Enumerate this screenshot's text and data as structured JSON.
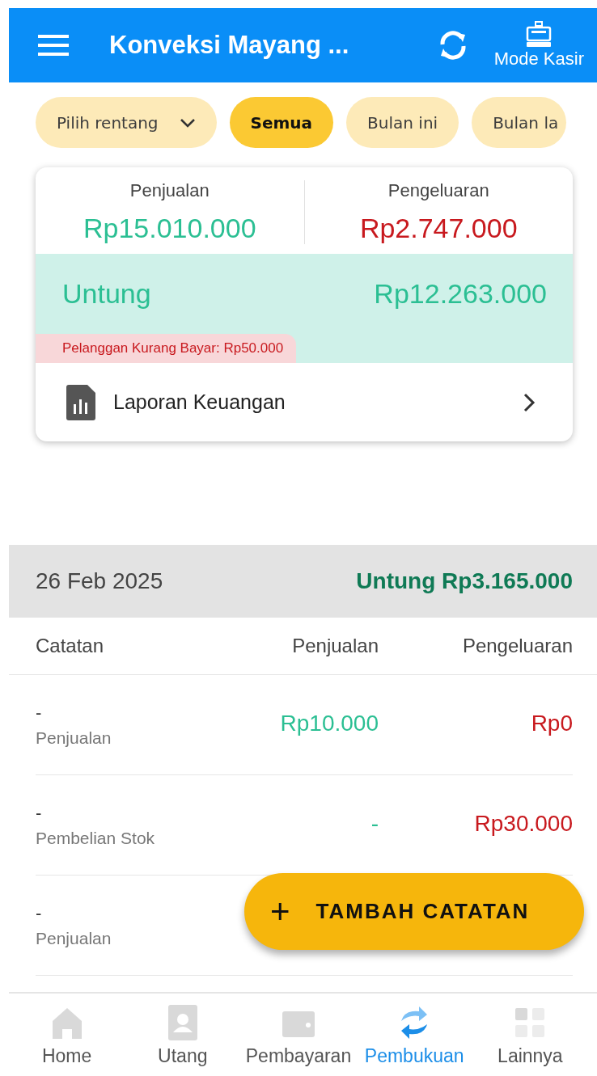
{
  "app_bar": {
    "title": "Konveksi Mayang ...",
    "cashier_label": "Mode Kasir"
  },
  "filters": [
    {
      "label": "Pilih rentang",
      "kind": "dropdown",
      "selected": false
    },
    {
      "label": "Semua",
      "kind": "chip",
      "selected": true
    },
    {
      "label": "Bulan ini",
      "kind": "chip",
      "selected": false
    },
    {
      "label": "Bulan la",
      "kind": "chip",
      "selected": false
    }
  ],
  "summary": {
    "sales_label": "Penjualan",
    "sales_value": "Rp15.010.000",
    "expense_label": "Pengeluaran",
    "expense_value": "Rp2.747.000",
    "profit_label": "Untung",
    "profit_value": "Rp12.263.000",
    "underpaid_note": "Pelanggan Kurang Bayar: Rp50.000",
    "report_link": "Laporan Keuangan"
  },
  "day": {
    "date": "26 Feb 2025",
    "profit": "Untung Rp3.165.000"
  },
  "table": {
    "columns": [
      "Catatan",
      "Penjualan",
      "Pengeluaran"
    ],
    "rows": [
      {
        "note": "-",
        "category": "Penjualan",
        "sales": "Rp10.000",
        "expense": "Rp0"
      },
      {
        "note": "-",
        "category": "Pembelian Stok",
        "sales": "-",
        "expense": "Rp30.000"
      },
      {
        "note": "-",
        "category": "Penjualan"
      }
    ]
  },
  "fab": {
    "icon": "+",
    "label": "TAMBAH CATATAN"
  },
  "bottom_nav": [
    {
      "label": "Home",
      "kind": "home",
      "selected": false
    },
    {
      "label": "Utang",
      "kind": "contact",
      "selected": false
    },
    {
      "label": "Pembayaran",
      "kind": "wallet",
      "selected": false
    },
    {
      "label": "Pembukuan",
      "kind": "sync",
      "selected": true
    },
    {
      "label": "Lainnya",
      "kind": "grid",
      "selected": false
    }
  ]
}
